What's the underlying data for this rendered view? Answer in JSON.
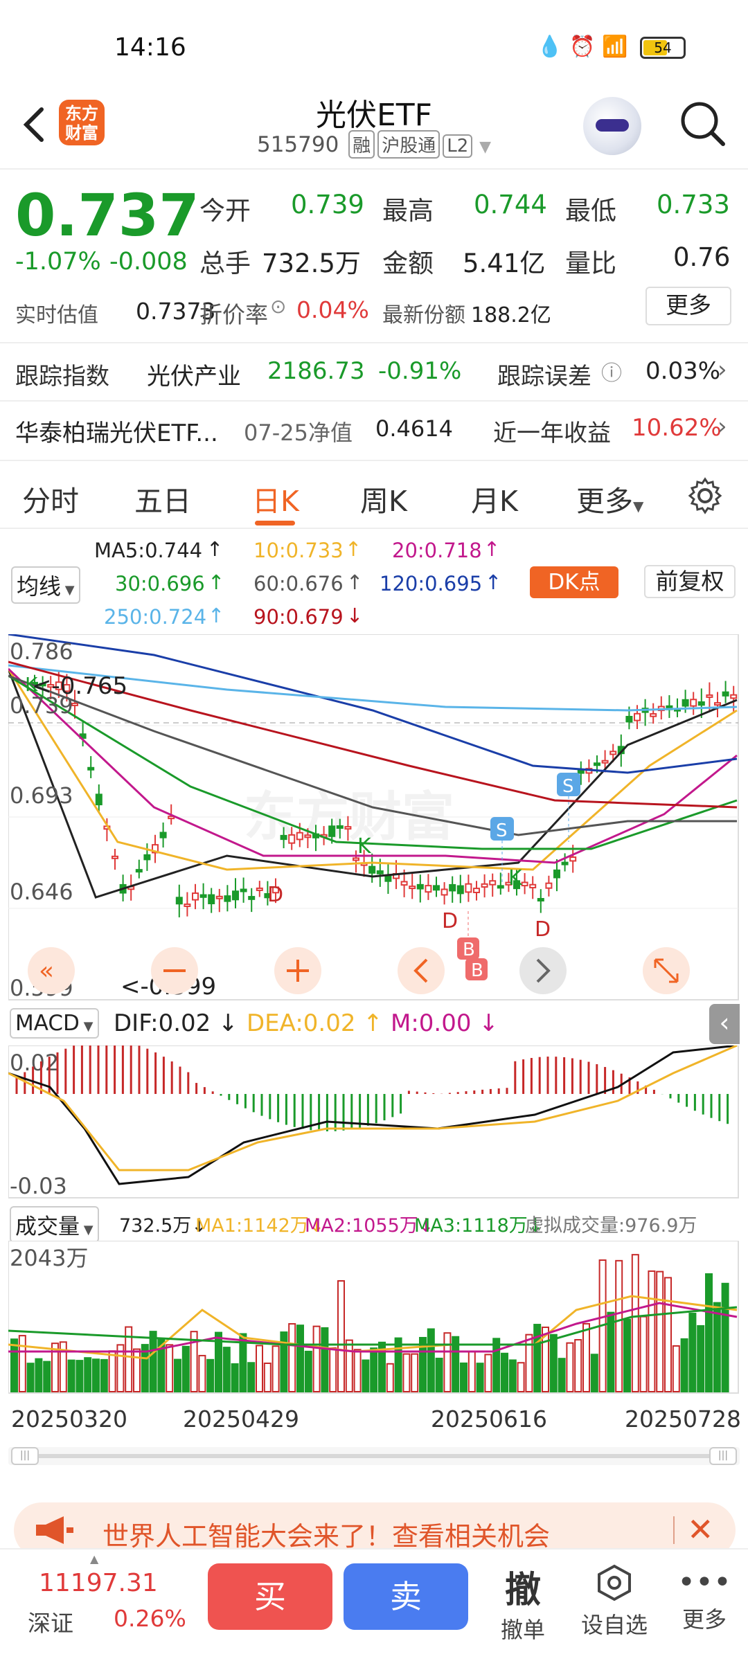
{
  "status_bar": {
    "time": "14:16",
    "battery": "54"
  },
  "header": {
    "logo_text": "东方财富",
    "title": "光伏ETF",
    "code": "515790",
    "tags": [
      "融",
      "沪股通",
      "L2"
    ]
  },
  "quote": {
    "price": "0.737",
    "change_pct": "-1.07%",
    "change": "-0.008",
    "open_label": "今开",
    "open": "0.739",
    "high_label": "最高",
    "high": "0.744",
    "low_label": "最低",
    "low": "0.733",
    "volume_label": "总手",
    "volume": "732.5万",
    "amount_label": "金额",
    "amount": "5.41亿",
    "ratio_label": "量比",
    "ratio": "0.76",
    "iopv_label": "实时估值",
    "iopv": "0.7373",
    "premium_label": "折价率",
    "premium": "0.04%",
    "shares_label": "最新份额",
    "shares": "188.2亿",
    "more_label": "更多"
  },
  "tracking": {
    "label": "跟踪指数",
    "index_name": "光伏产业",
    "index_value": "2186.73",
    "index_change": "-0.91%",
    "error_label": "跟踪误差",
    "error_value": "0.03%"
  },
  "fund": {
    "name": "华泰柏瑞光伏ETF...",
    "nav_label": "07-25净值",
    "nav": "0.4614",
    "return_label": "近一年收益",
    "return_value": "10.62%"
  },
  "tabs": [
    "分时",
    "五日",
    "日K",
    "周K",
    "月K",
    "更多"
  ],
  "active_tab": "日K",
  "ma_legend": {
    "dropdown": "均线",
    "ma5": "MA5:0.744",
    "ma10": "10:0.733",
    "ma20": "20:0.718",
    "ma30": "30:0.696",
    "ma60": "60:0.676",
    "ma120": "120:0.695",
    "ma250": "250:0.724",
    "ma90": "90:0.679",
    "dk_button": "DK点",
    "adjust_button": "前复权"
  },
  "kline": {
    "y_labels": [
      "0.786",
      "0.739",
      "0.693",
      "0.646",
      "0.599"
    ],
    "max_label": "<-0.765",
    "min_label": "<-0.599",
    "signals": [
      "K",
      "D",
      "K",
      "D",
      "K",
      "D",
      "S",
      "S",
      "B",
      "B"
    ]
  },
  "macd": {
    "dropdown": "MACD",
    "dif": "DIF:0.02",
    "dea": "DEA:0.02",
    "m": "M:0.00",
    "y_top": "0.02",
    "y_bottom": "-0.03"
  },
  "volume": {
    "dropdown": "成交量",
    "vol": "732.5万",
    "ma1": "MA1:1142万",
    "ma2": "MA2:1055万",
    "ma3": "MA3:1118万",
    "virtual": "虚拟成交量:976.9万",
    "y_top": "2043万"
  },
  "dates": [
    "20250320",
    "20250429",
    "20250616",
    "20250728"
  ],
  "banner": {
    "text": "世界人工智能大会来了！查看相关机会"
  },
  "bottom_bar": {
    "index_value": "11197.31",
    "index_name": "深证",
    "index_change": "0.26%",
    "buy": "买",
    "sell": "卖",
    "cancel_icon_text": "撤",
    "cancel": "撤单",
    "watch": "设自选",
    "more": "更多"
  },
  "colors": {
    "up": "#e03a3a",
    "down": "#1a9a2a",
    "brand": "#f06424"
  }
}
